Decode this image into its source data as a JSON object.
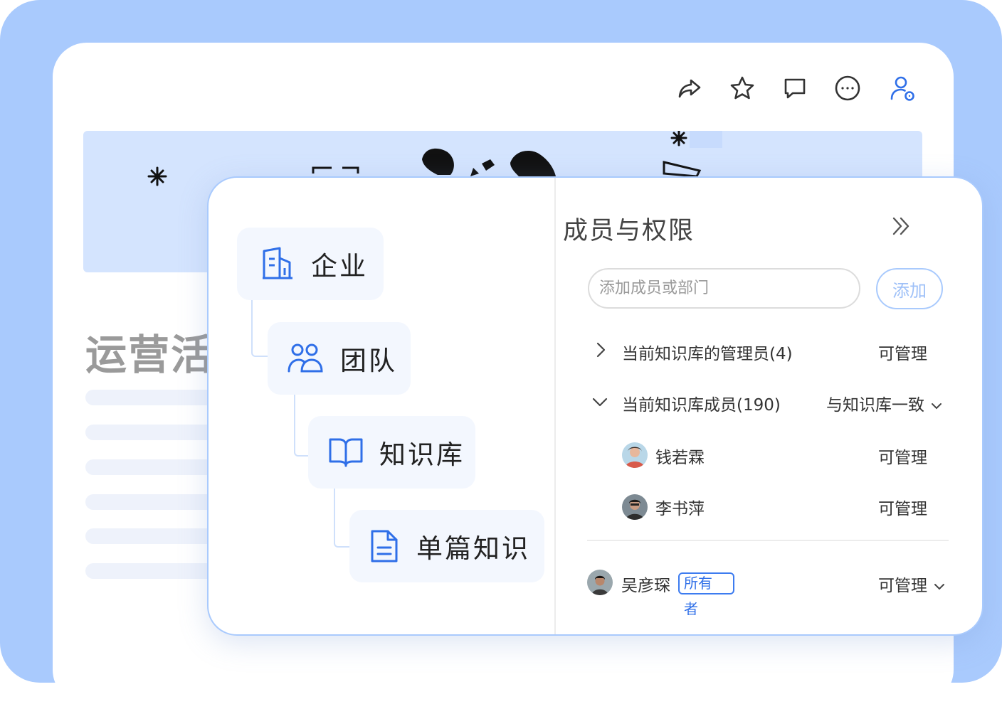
{
  "toolbar": {
    "icons": [
      "share-icon",
      "star-icon",
      "comment-icon",
      "more-icon",
      "permission-icon"
    ]
  },
  "document": {
    "title": "运营活动"
  },
  "hierarchy": {
    "levels": [
      {
        "label": "企业",
        "icon": "building-icon"
      },
      {
        "label": "团队",
        "icon": "team-icon"
      },
      {
        "label": "知识库",
        "icon": "book-icon"
      },
      {
        "label": "单篇知识",
        "icon": "document-icon"
      }
    ]
  },
  "panel": {
    "title": "成员与权限",
    "search_placeholder": "添加成员或部门",
    "add_label": "添加",
    "admins_group": {
      "label": "当前知识库的管理员(4)",
      "permission": "可管理",
      "expanded": false
    },
    "members_group": {
      "label": "当前知识库成员(190)",
      "permission": "与知识库一致",
      "expanded": true
    },
    "members": [
      {
        "name": "钱若霖",
        "permission": "可管理"
      },
      {
        "name": "李书萍",
        "permission": "可管理"
      }
    ],
    "owner": {
      "name": "吴彦琛",
      "badge_line1": "所有",
      "badge_line2": "者",
      "permission": "可管理"
    }
  },
  "colors": {
    "accent": "#2f6fe8",
    "frame": "#a9cafd",
    "banner": "#d4e4fe"
  }
}
